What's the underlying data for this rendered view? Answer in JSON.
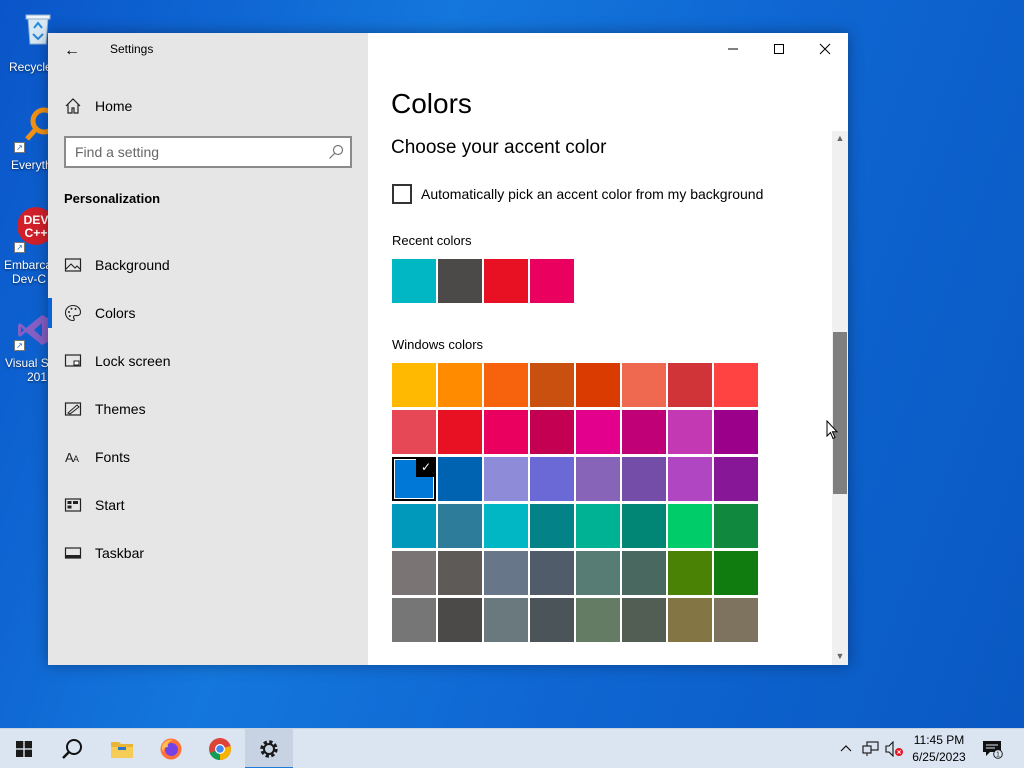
{
  "desktop": {
    "icons": [
      {
        "label": "Recycle",
        "icon": "recycle-bin-icon"
      },
      {
        "label": "Everyth",
        "icon": "everything-search-icon"
      },
      {
        "label": "Embarca",
        "label2": "Dev-C",
        "icon": "devcpp-icon"
      },
      {
        "label": "Visual S",
        "label2": "201",
        "icon": "visual-studio-icon"
      }
    ]
  },
  "window": {
    "app_title": "Settings",
    "controls": {
      "minimize": "minimize-icon",
      "maximize": "maximize-icon",
      "close": "close-icon"
    }
  },
  "sidebar": {
    "home_label": "Home",
    "search_placeholder": "Find a setting",
    "section_title": "Personalization",
    "items": [
      {
        "label": "Background",
        "icon": "picture-icon"
      },
      {
        "label": "Colors",
        "icon": "palette-icon",
        "selected": true
      },
      {
        "label": "Lock screen",
        "icon": "lock-screen-icon"
      },
      {
        "label": "Themes",
        "icon": "themes-icon"
      },
      {
        "label": "Fonts",
        "icon": "fonts-icon"
      },
      {
        "label": "Start",
        "icon": "start-icon"
      },
      {
        "label": "Taskbar",
        "icon": "taskbar-icon"
      }
    ]
  },
  "main": {
    "page_title": "Colors",
    "accent_heading": "Choose your accent color",
    "auto_pick_label": "Automatically pick an accent color from my background",
    "auto_pick_checked": false,
    "recent_label": "Recent colors",
    "recent_colors": [
      "#00b7c3",
      "#4c4a48",
      "#e81123",
      "#ea005e"
    ],
    "windows_label": "Windows colors",
    "windows_colors": [
      [
        "#ffb900",
        "#ff8c00",
        "#f7630c",
        "#ca5010",
        "#da3b01",
        "#ef6950",
        "#d13438",
        "#ff4343"
      ],
      [
        "#e74856",
        "#e81123",
        "#ea005e",
        "#c30052",
        "#e3008c",
        "#bf0077",
        "#c239b3",
        "#9a0089"
      ],
      [
        "#0078d7",
        "#0063b1",
        "#8e8cd8",
        "#6b69d6",
        "#8764b8",
        "#744da9",
        "#b146c2",
        "#881798"
      ],
      [
        "#0099bc",
        "#2d7d9a",
        "#00b7c3",
        "#038387",
        "#00b294",
        "#018574",
        "#00cc6a",
        "#10893e"
      ],
      [
        "#7a7574",
        "#5d5a58",
        "#68768a",
        "#515c6b",
        "#567c73",
        "#486860",
        "#498205",
        "#107c10"
      ],
      [
        "#767676",
        "#4c4a48",
        "#69797e",
        "#4a5459",
        "#647c64",
        "#525e54",
        "#847545",
        "#7e735f"
      ]
    ],
    "selected_color": "#0078d7"
  },
  "taskbar": {
    "apps": [
      {
        "name": "start-button",
        "icon": "windows-logo-icon"
      },
      {
        "name": "search-button",
        "icon": "search-icon"
      },
      {
        "name": "file-explorer-button",
        "icon": "folder-icon"
      },
      {
        "name": "firefox-button",
        "icon": "firefox-icon"
      },
      {
        "name": "chrome-button",
        "icon": "chrome-icon"
      },
      {
        "name": "settings-button",
        "icon": "gear-icon",
        "active": true
      }
    ],
    "time": "11:45 PM",
    "date": "6/25/2023",
    "notification_count": "1"
  }
}
